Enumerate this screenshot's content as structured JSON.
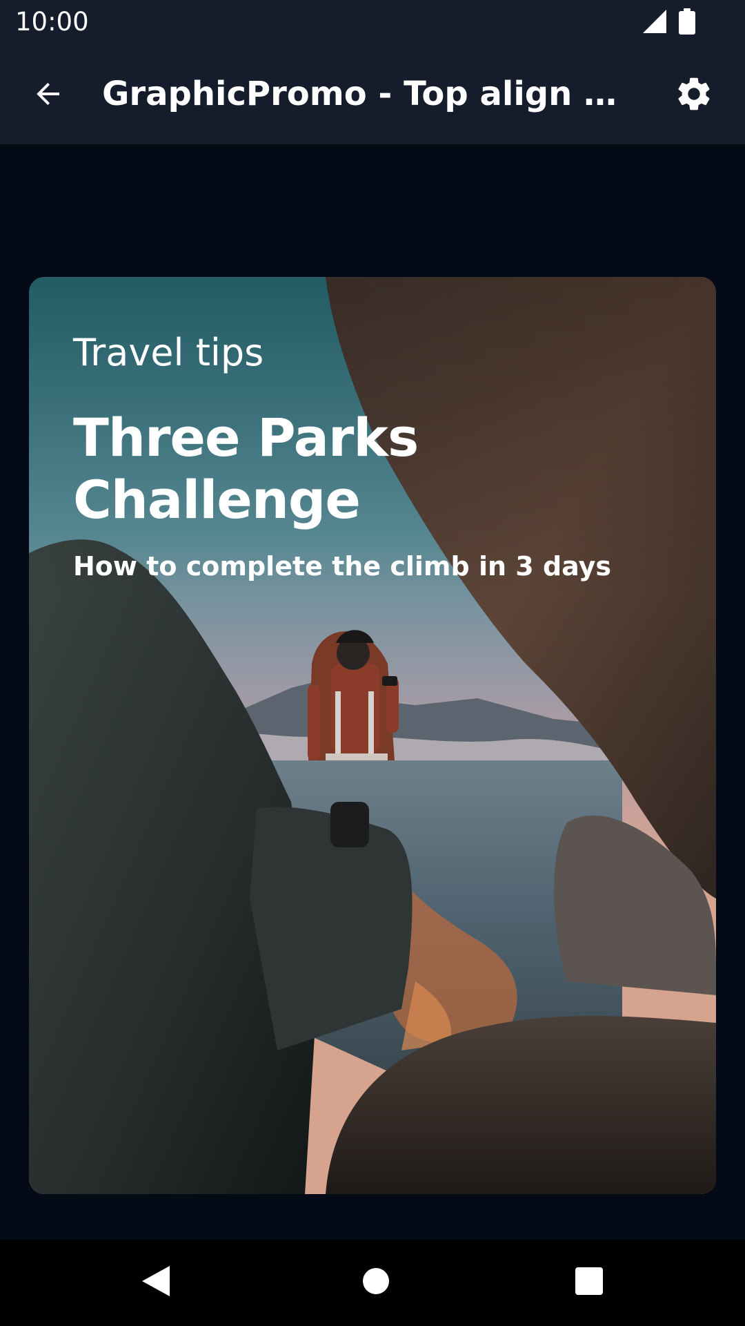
{
  "status_bar": {
    "time": "10:00",
    "icons": [
      "signal-icon",
      "battery-icon"
    ]
  },
  "app_bar": {
    "title": "GraphicPromo - Top align with text",
    "back_icon": "arrow-back-icon",
    "settings_icon": "gear-icon"
  },
  "promo": {
    "eyebrow": "Travel tips",
    "title": "Three Parks Challenge",
    "subtitle": "How to complete the climb in 3 days",
    "image": "hiker-with-backpack-between-rocks-photo"
  },
  "nav_bar": {
    "icons": [
      "triangle-back-icon",
      "circle-home-icon",
      "square-recents-icon"
    ]
  },
  "colors": {
    "background": "#050b16",
    "app_bar": "#151d2c",
    "text": "#ffffff",
    "nav_bar": "#000000"
  }
}
